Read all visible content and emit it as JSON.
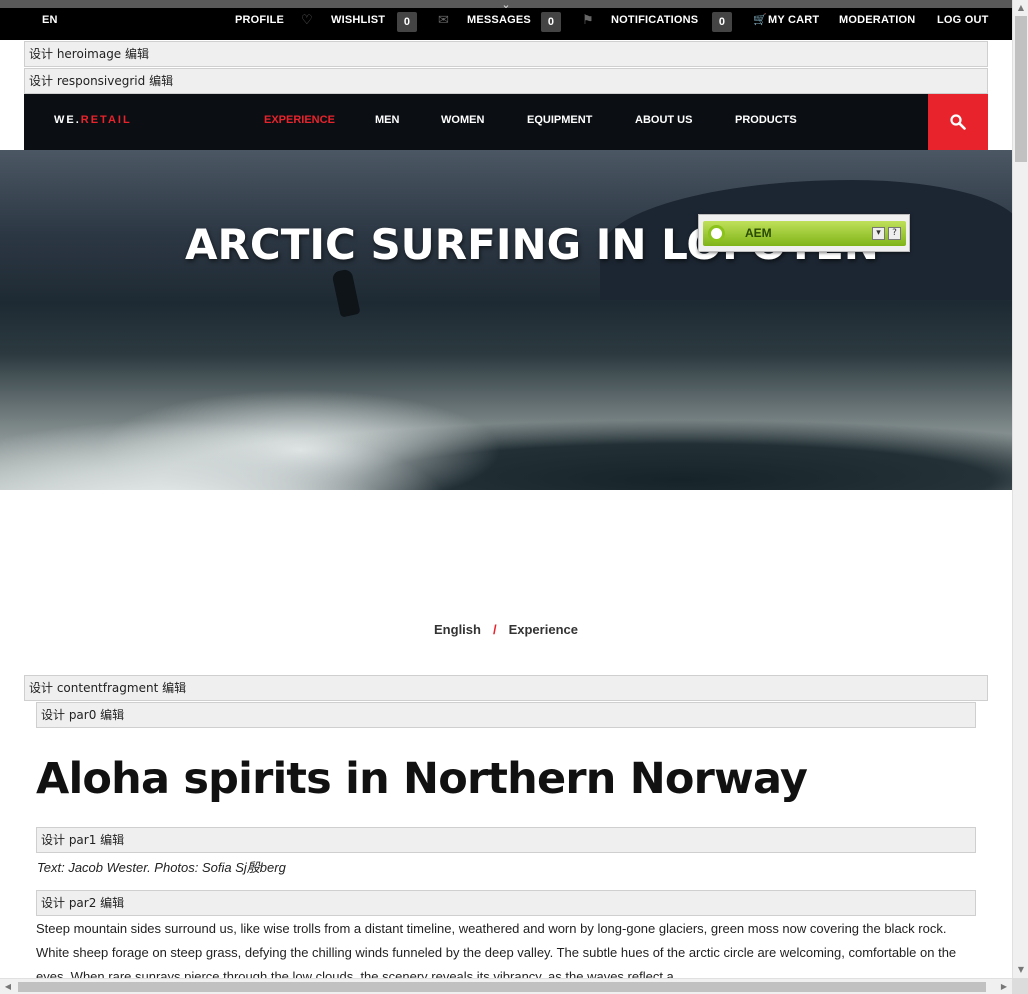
{
  "userbar": {
    "language": "EN",
    "profile": "PROFILE",
    "wishlist": "WISHLIST",
    "wishlist_count": "0",
    "messages": "MESSAGES",
    "messages_count": "0",
    "notifications": "NOTIFICATIONS",
    "notifications_count": "0",
    "cart": "MY CART",
    "moderation": "MODERATION",
    "logout": "LOG OUT"
  },
  "editbars": {
    "heroimage": "设计 heroimage 编辑",
    "responsivegrid": "设计 responsivegrid 编辑",
    "contentfragment": "设计 contentfragment 编辑",
    "par0": "设计 par0 编辑",
    "par1": "设计 par1 编辑",
    "par2": "设计 par2 编辑"
  },
  "nav": {
    "brand_we": "WE.",
    "brand_retail": "RETAIL",
    "items": [
      {
        "label": "EXPERIENCE"
      },
      {
        "label": "MEN"
      },
      {
        "label": "WOMEN"
      },
      {
        "label": "EQUIPMENT"
      },
      {
        "label": "ABOUT US"
      },
      {
        "label": "PRODUCTS"
      }
    ]
  },
  "hero": {
    "title": "ARCTIC SURFING IN LOFOTEN"
  },
  "aem_widget": {
    "label": "AEM"
  },
  "breadcrumb": {
    "items": [
      "English",
      "Experience"
    ],
    "separator": "/"
  },
  "article": {
    "title": "Aloha spirits in Northern Norway",
    "byline": "Text: Jacob Wester. Photos: Sofia Sj殷berg",
    "body": "Steep mountain sides surround us, like wise trolls from a distant timeline, weathered and worn by long-gone glaciers, green moss now covering the black rock. White sheep forage on steep grass, defying the chilling winds funneled by the deep valley. The subtle hues of the arctic circle are welcoming, comfortable on the eyes. When rare sunrays pierce through the low clouds, the scenery reveals its vibrancy, as the waves reflect a"
  },
  "colors": {
    "accent": "#e8232c",
    "nav_bg": "#0b0f14",
    "aem_green": "#8cc21c"
  }
}
